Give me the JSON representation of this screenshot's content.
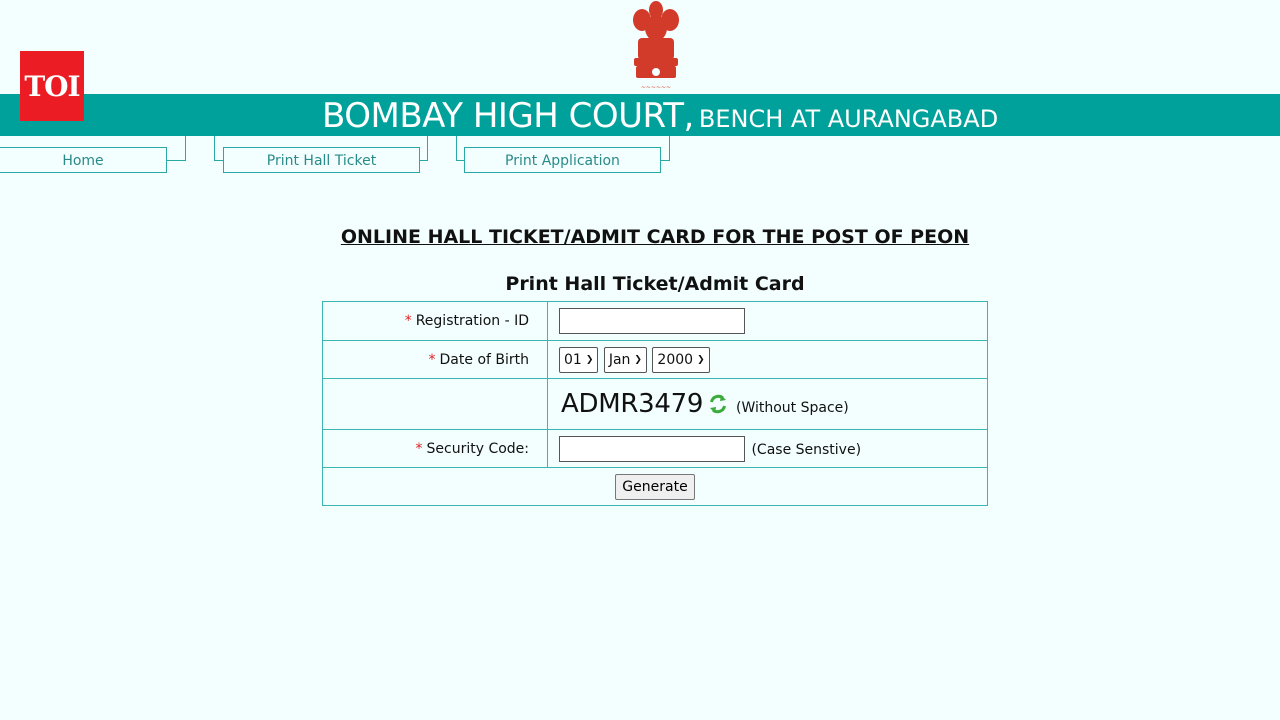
{
  "logo": {
    "text": "TOI",
    "color": "#ec1c24"
  },
  "header": {
    "title": "BOMBAY HIGH COURT,",
    "subtitle": "BENCH AT AURANGABAD",
    "banner_color": "#00a19a",
    "emblem_icon": "national-emblem-icon"
  },
  "nav": {
    "items": [
      {
        "label": "Home"
      },
      {
        "label": "Print Hall Ticket"
      },
      {
        "label": "Print Application"
      }
    ]
  },
  "page": {
    "heading": "ONLINE HALL TICKET/ADMIT CARD FOR THE POST OF PEON",
    "subheading": "Print Hall Ticket/Admit Card"
  },
  "form": {
    "registration_label": "Registration - ID",
    "registration_value": "",
    "dob_label": "Date of Birth",
    "dob_day": "01",
    "dob_month": "Jan",
    "dob_year": "2000",
    "captcha_text": "ADMR3479",
    "captcha_note": "(Without Space)",
    "refresh_icon": "refresh-icon",
    "security_label": "Security Code:",
    "security_value": "",
    "security_note": "(Case Senstive)",
    "required_marker": "*",
    "generate_label": "Generate"
  }
}
